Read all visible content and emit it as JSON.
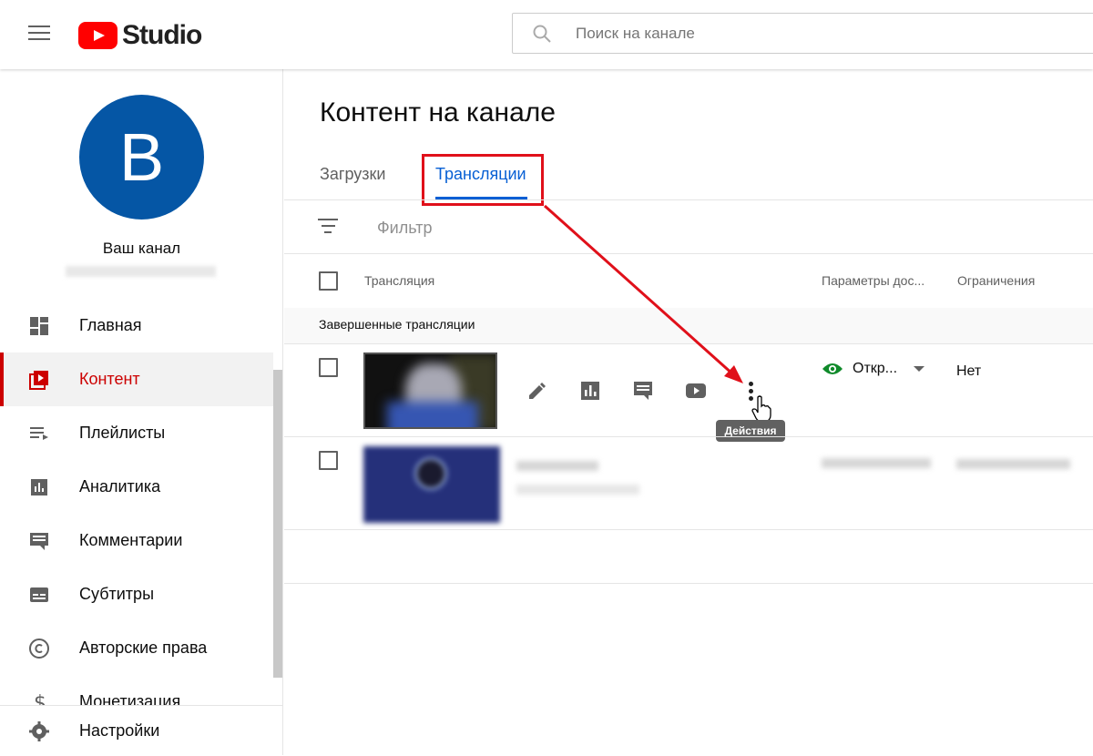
{
  "app": {
    "logo_text": "Studio"
  },
  "search": {
    "placeholder": "Поиск на канале"
  },
  "sidebar": {
    "avatar_letter": "B",
    "channel_label": "Ваш канал",
    "items": [
      {
        "label": "Главная",
        "icon": "dashboard-icon"
      },
      {
        "label": "Контент",
        "icon": "content-icon",
        "active": true
      },
      {
        "label": "Плейлисты",
        "icon": "playlist-icon"
      },
      {
        "label": "Аналитика",
        "icon": "analytics-icon"
      },
      {
        "label": "Комментарии",
        "icon": "comment-icon"
      },
      {
        "label": "Субтитры",
        "icon": "subtitles-icon"
      },
      {
        "label": "Авторские права",
        "icon": "copyright-icon"
      },
      {
        "label": "Монетизация",
        "icon": "dollar-icon"
      }
    ],
    "settings_label": "Настройки"
  },
  "main": {
    "title": "Контент на канале",
    "tabs": [
      {
        "label": "Загрузки",
        "active": false
      },
      {
        "label": "Трансляции",
        "active": true
      }
    ],
    "filter_label": "Фильтр",
    "columns": [
      "Трансляция",
      "Параметры дос...",
      "Ограничения"
    ],
    "section_title": "Завершенные трансляции",
    "rows": [
      {
        "visibility": "Откр...",
        "restrictions": "Нет",
        "tooltip": "Действия"
      }
    ]
  },
  "colors": {
    "accent": "#065fd4",
    "active_nav": "#cc0000",
    "highlight": "#e0101a",
    "avatar": "#0556a5",
    "public_eye": "#0f8a2a"
  }
}
